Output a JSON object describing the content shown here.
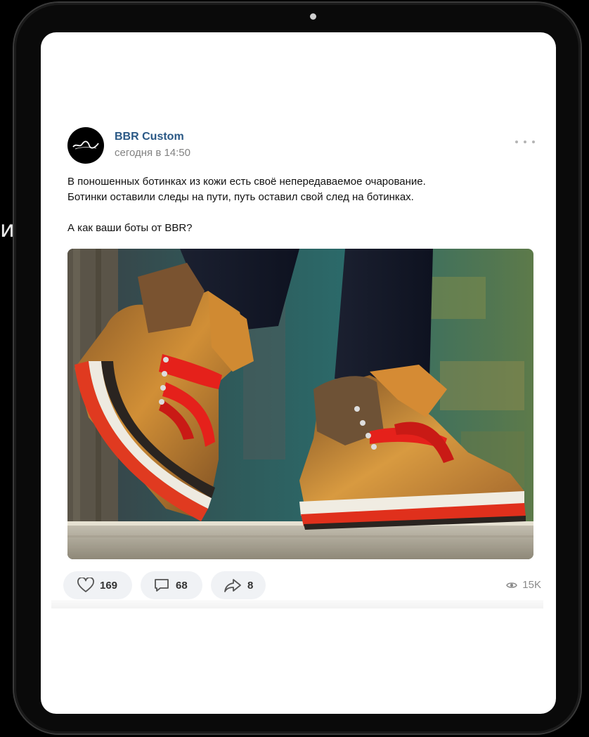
{
  "side_fragment": "и:",
  "post": {
    "author": "BBR Custom",
    "timestamp": "сегодня в 14:50",
    "text_lines": [
      "В поношенных ботинках из кожи есть своё непередаваемое очарование.",
      "Ботинки оставили следы на пути, путь оставил свой след на ботинках."
    ],
    "question": "А как ваши боты от BBR?",
    "actions": {
      "likes": "169",
      "comments": "68",
      "reposts": "8",
      "views": "15K"
    }
  },
  "icons": {
    "like": "heart-icon",
    "comment": "comment-icon",
    "share": "share-icon",
    "views": "eye-icon",
    "more": "more-dots-icon"
  },
  "colors": {
    "author_link": "#2a5885",
    "laces": "#e5211b",
    "boot_leather": "#c07a2a"
  }
}
